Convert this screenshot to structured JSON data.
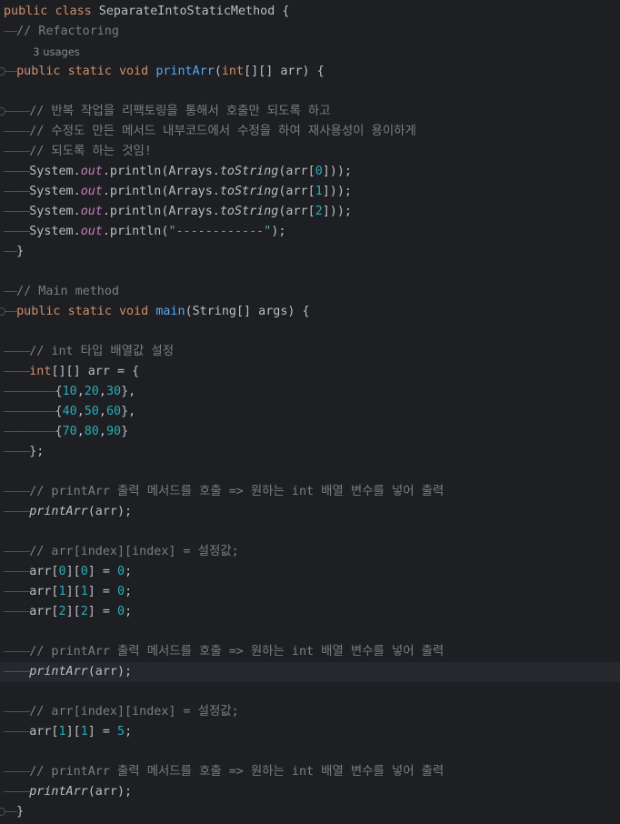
{
  "editor": {
    "language": "java",
    "theme": {
      "background": "#1e1f22",
      "keyword": "#cf8e6d",
      "method": "#56a8f5",
      "number": "#2aacb8",
      "string": "#6aab73",
      "comment": "#7a7e85",
      "field": "#c77dbb"
    },
    "lines": [
      {
        "tokens": [
          [
            "kw",
            "public"
          ],
          [
            "plain",
            " "
          ],
          [
            "kw",
            "class"
          ],
          [
            "plain",
            " SeparateIntoStaticMethod {"
          ]
        ]
      },
      {
        "guide": "——",
        "tokens": [
          [
            "cmt",
            "// Refactoring"
          ]
        ]
      },
      {
        "guide": "",
        "indent": 1,
        "tokens": [
          [
            "usages",
            "3 usages"
          ]
        ]
      },
      {
        "guide": "——",
        "fold": true,
        "tokens": [
          [
            "kw",
            "public"
          ],
          [
            "plain",
            " "
          ],
          [
            "kw",
            "static"
          ],
          [
            "plain",
            " "
          ],
          [
            "kw",
            "void"
          ],
          [
            "plain",
            " "
          ],
          [
            "fn",
            "printArr"
          ],
          [
            "plain",
            "("
          ],
          [
            "kw",
            "int"
          ],
          [
            "plain",
            "[][] arr) {"
          ]
        ]
      },
      {
        "tokens": []
      },
      {
        "guide": "————",
        "fold": true,
        "tokens": [
          [
            "cmt",
            "// 반복 작업을 리팩토링을 통해서 호출만 되도록 하고"
          ]
        ]
      },
      {
        "guide": "————",
        "tokens": [
          [
            "cmt",
            "// 수정도 만든 메서드 내부코드에서 수정을 하여 재사용성이 용이하게"
          ]
        ]
      },
      {
        "guide": "————",
        "tokens": [
          [
            "cmt",
            "// 되도록 하는 것임!"
          ]
        ]
      },
      {
        "guide": "————",
        "tokens": [
          [
            "plain",
            "System."
          ],
          [
            "field",
            "out"
          ],
          [
            "plain",
            ".println(Arrays."
          ],
          [
            "static-m",
            "toString"
          ],
          [
            "plain",
            "(arr["
          ],
          [
            "num",
            "0"
          ],
          [
            "plain",
            "]));"
          ]
        ]
      },
      {
        "guide": "————",
        "tokens": [
          [
            "plain",
            "System."
          ],
          [
            "field",
            "out"
          ],
          [
            "plain",
            ".println(Arrays."
          ],
          [
            "static-m",
            "toString"
          ],
          [
            "plain",
            "(arr["
          ],
          [
            "num",
            "1"
          ],
          [
            "plain",
            "]));"
          ]
        ]
      },
      {
        "guide": "————",
        "tokens": [
          [
            "plain",
            "System."
          ],
          [
            "field",
            "out"
          ],
          [
            "plain",
            ".println(Arrays."
          ],
          [
            "static-m",
            "toString"
          ],
          [
            "plain",
            "(arr["
          ],
          [
            "num",
            "2"
          ],
          [
            "plain",
            "]));"
          ]
        ]
      },
      {
        "guide": "————",
        "tokens": [
          [
            "plain",
            "System."
          ],
          [
            "field",
            "out"
          ],
          [
            "plain",
            ".println("
          ],
          [
            "str",
            "\"------------\""
          ],
          [
            "plain",
            ");"
          ]
        ]
      },
      {
        "guide": "——",
        "tokens": [
          [
            "plain",
            "}"
          ]
        ]
      },
      {
        "tokens": []
      },
      {
        "guide": "——",
        "tokens": [
          [
            "cmt",
            "// Main method"
          ]
        ]
      },
      {
        "guide": "——",
        "fold": true,
        "tokens": [
          [
            "kw",
            "public"
          ],
          [
            "plain",
            " "
          ],
          [
            "kw",
            "static"
          ],
          [
            "plain",
            " "
          ],
          [
            "kw",
            "void"
          ],
          [
            "plain",
            " "
          ],
          [
            "fn",
            "main"
          ],
          [
            "plain",
            "(String[] args) {"
          ]
        ]
      },
      {
        "tokens": []
      },
      {
        "guide": "————",
        "tokens": [
          [
            "cmt",
            "// int 타입 배열값 설정"
          ]
        ]
      },
      {
        "guide": "————",
        "tokens": [
          [
            "kw",
            "int"
          ],
          [
            "plain",
            "[][] arr = {"
          ]
        ]
      },
      {
        "guide": "————————",
        "tokens": [
          [
            "plain",
            "{"
          ],
          [
            "num",
            "10"
          ],
          [
            "plain",
            ","
          ],
          [
            "num",
            "20"
          ],
          [
            "plain",
            ","
          ],
          [
            "num",
            "30"
          ],
          [
            "plain",
            "},"
          ]
        ]
      },
      {
        "guide": "————————",
        "tokens": [
          [
            "plain",
            "{"
          ],
          [
            "num",
            "40"
          ],
          [
            "plain",
            ","
          ],
          [
            "num",
            "50"
          ],
          [
            "plain",
            ","
          ],
          [
            "num",
            "60"
          ],
          [
            "plain",
            "},"
          ]
        ]
      },
      {
        "guide": "————————",
        "tokens": [
          [
            "plain",
            "{"
          ],
          [
            "num",
            "70"
          ],
          [
            "plain",
            ","
          ],
          [
            "num",
            "80"
          ],
          [
            "plain",
            ","
          ],
          [
            "num",
            "90"
          ],
          [
            "plain",
            "}"
          ]
        ]
      },
      {
        "guide": "————",
        "tokens": [
          [
            "plain",
            "};"
          ]
        ]
      },
      {
        "tokens": []
      },
      {
        "guide": "————",
        "tokens": [
          [
            "cmt",
            "// printArr 출력 메서드를 호출 => 원하는 int 배열 변수를 넣어 출력"
          ]
        ]
      },
      {
        "guide": "————",
        "tokens": [
          [
            "fn-static-call",
            "printArr"
          ],
          [
            "plain",
            "(arr);"
          ]
        ]
      },
      {
        "tokens": []
      },
      {
        "guide": "————",
        "tokens": [
          [
            "cmt",
            "// arr[index][index] = 설정값;"
          ]
        ]
      },
      {
        "guide": "————",
        "tokens": [
          [
            "plain",
            "arr["
          ],
          [
            "num",
            "0"
          ],
          [
            "plain",
            "]["
          ],
          [
            "num",
            "0"
          ],
          [
            "plain",
            "] = "
          ],
          [
            "num",
            "0"
          ],
          [
            "plain",
            ";"
          ]
        ]
      },
      {
        "guide": "————",
        "tokens": [
          [
            "plain",
            "arr["
          ],
          [
            "num",
            "1"
          ],
          [
            "plain",
            "]["
          ],
          [
            "num",
            "1"
          ],
          [
            "plain",
            "] = "
          ],
          [
            "num",
            "0"
          ],
          [
            "plain",
            ";"
          ]
        ]
      },
      {
        "guide": "————",
        "tokens": [
          [
            "plain",
            "arr["
          ],
          [
            "num",
            "2"
          ],
          [
            "plain",
            "]["
          ],
          [
            "num",
            "2"
          ],
          [
            "plain",
            "] = "
          ],
          [
            "num",
            "0"
          ],
          [
            "plain",
            ";"
          ]
        ]
      },
      {
        "tokens": []
      },
      {
        "guide": "————",
        "tokens": [
          [
            "cmt",
            "// printArr 출력 메서드를 호출 => 원하는 int 배열 변수를 넣어 출력"
          ]
        ]
      },
      {
        "guide": "————",
        "current": true,
        "tokens": [
          [
            "fn-static-call",
            "printArr"
          ],
          [
            "plain",
            "(arr);"
          ]
        ]
      },
      {
        "tokens": []
      },
      {
        "guide": "————",
        "tokens": [
          [
            "cmt",
            "// arr[index][index] = 설정값;"
          ]
        ]
      },
      {
        "guide": "————",
        "tokens": [
          [
            "plain",
            "arr["
          ],
          [
            "num",
            "1"
          ],
          [
            "plain",
            "]["
          ],
          [
            "num",
            "1"
          ],
          [
            "plain",
            "] = "
          ],
          [
            "num",
            "5"
          ],
          [
            "plain",
            ";"
          ]
        ]
      },
      {
        "tokens": []
      },
      {
        "guide": "————",
        "tokens": [
          [
            "cmt",
            "// printArr 출력 메서드를 호출 => 원하는 int 배열 변수를 넣어 출력"
          ]
        ]
      },
      {
        "guide": "————",
        "tokens": [
          [
            "fn-static-call",
            "printArr"
          ],
          [
            "plain",
            "(arr);"
          ]
        ]
      },
      {
        "guide": "——",
        "fold": true,
        "tokens": [
          [
            "plain",
            "}"
          ]
        ]
      }
    ]
  }
}
